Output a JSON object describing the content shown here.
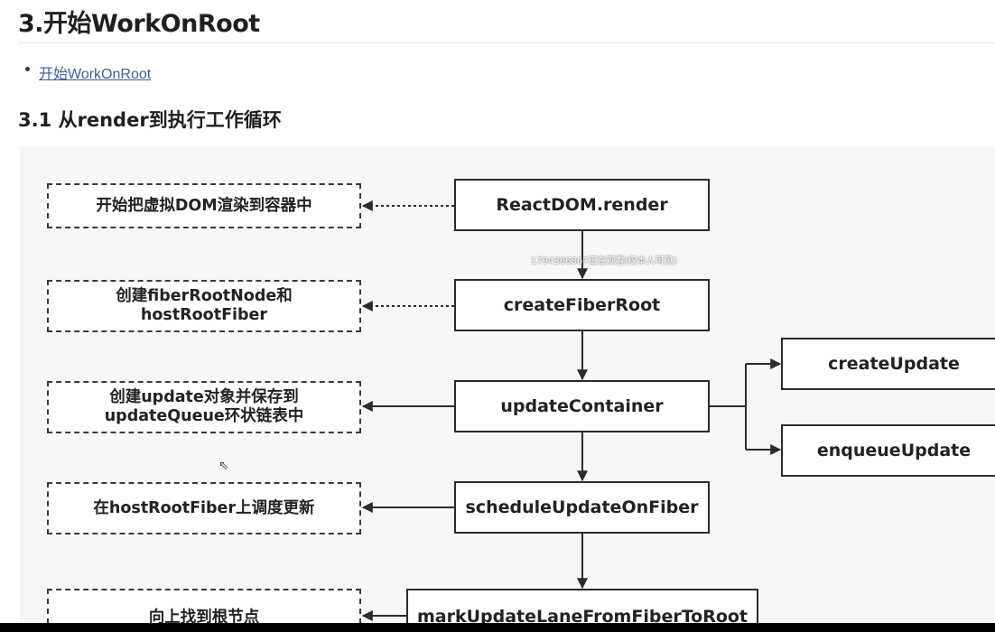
{
  "header": {
    "title": "3.开始WorkOnRoot",
    "link_text": "开始WorkOnRoot",
    "section_title": "3.1 从render到执行工作循环"
  },
  "diagram": {
    "main_nodes": {
      "render": "ReactDOM.render",
      "create_root": "createFiberRoot",
      "update_container": "updateContainer",
      "schedule": "scheduleUpdateOnFiber",
      "mark_lane": "markUpdateLaneFromFiberToRoot"
    },
    "notes": {
      "render": "开始把虚拟DOM渲染到容器中",
      "create_root_line1": "创建fiberRootNode和",
      "create_root_line2": "hostRootFiber",
      "update_line1": "创建update对象并保存到",
      "update_line2": "updateQueue环状链表中",
      "schedule": "在hostRootFiber上调度更新",
      "mark_lane": "向上找到根节点"
    },
    "branch_nodes": {
      "create_update": "createUpdate",
      "enqueue_update": "enqueueUpdate"
    },
    "watermark": "1794366867正在观看(仅本人可见)"
  },
  "colors": {
    "link": "#3b5ea0",
    "stroke": "#2b2b2b",
    "diagram_bg": "#f7f7f7"
  }
}
